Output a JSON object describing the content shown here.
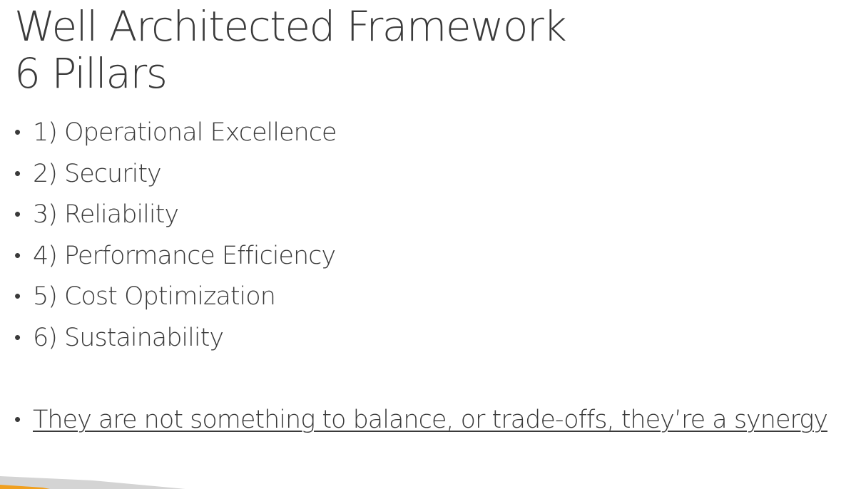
{
  "title": {
    "line1": "Well Architected Framework",
    "line2": "6 Pillars"
  },
  "bullets": [
    "1) Operational Excellence",
    "2) Security",
    "3) Reliability",
    "4) Performance Efficiency",
    "5) Cost Optimization",
    "6) Sustainability"
  ],
  "note": "They are not something to balance, or trade-offs, they’re a synergy",
  "bullet_glyph": "•",
  "colors": {
    "text": "#3a3a3a",
    "corner_gray": "#d4d4d4",
    "corner_orange": "#f0a020"
  }
}
